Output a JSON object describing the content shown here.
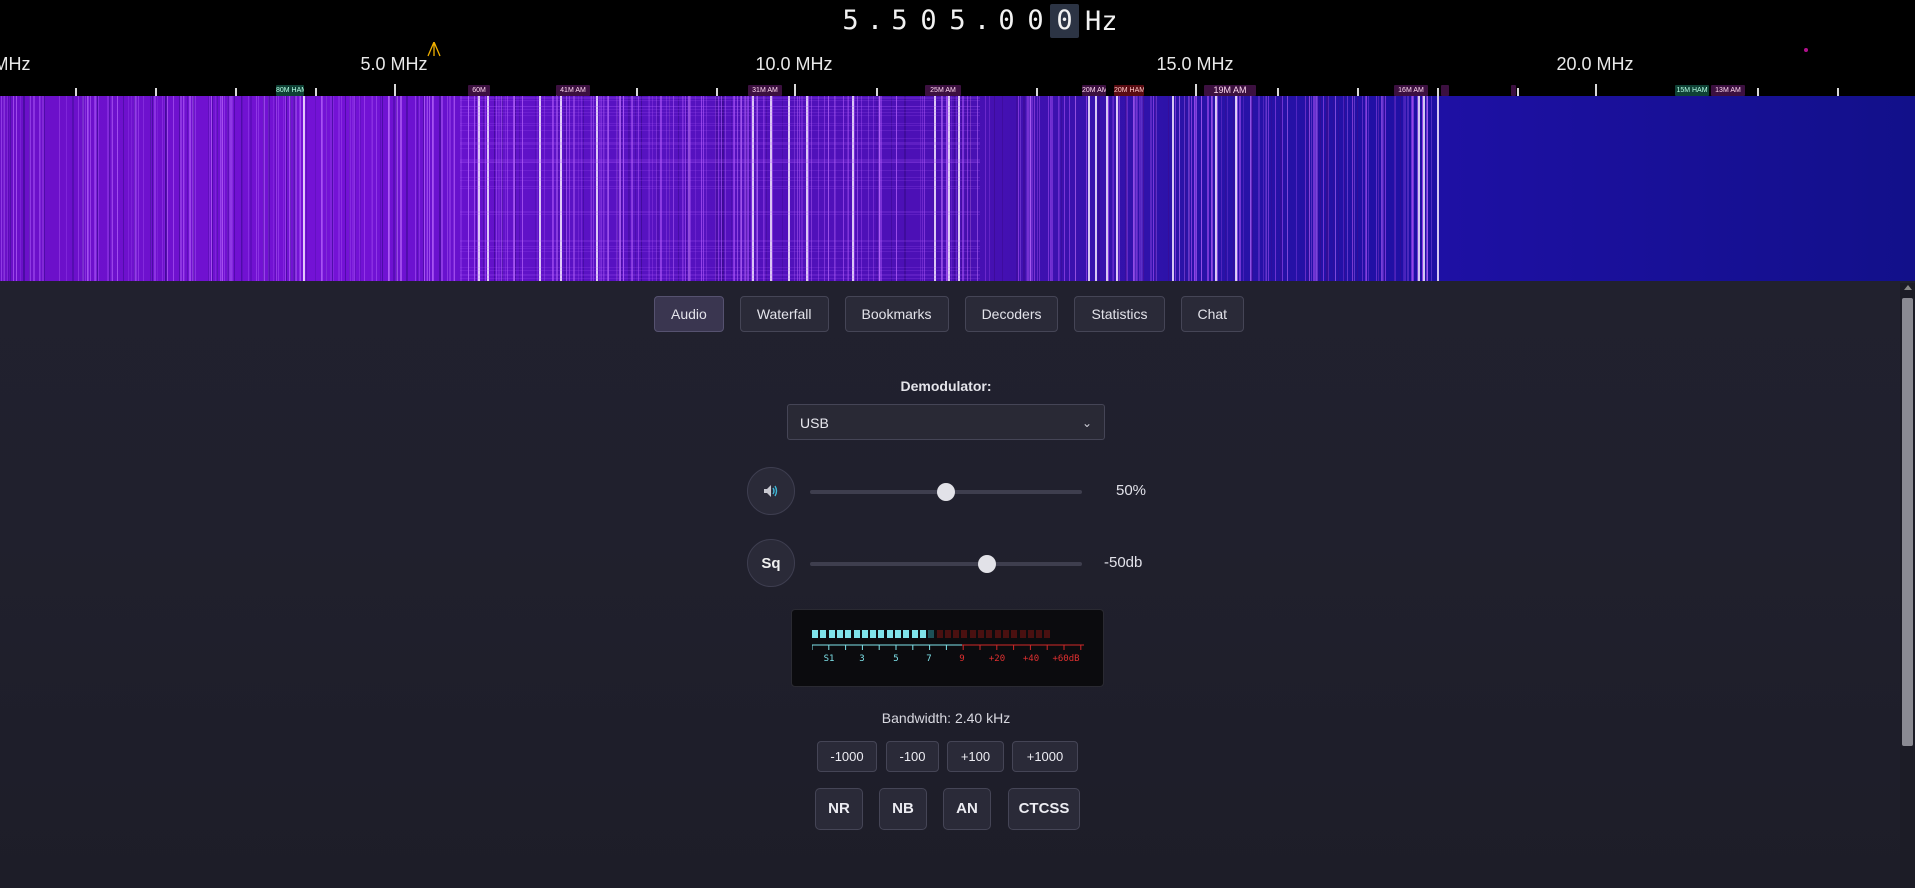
{
  "frequency": {
    "digits": [
      "5",
      ".",
      "5",
      "0",
      "5",
      ".",
      "0",
      "0",
      "0"
    ],
    "selected_digit_index": 8,
    "unit": "Hz"
  },
  "scale": {
    "labels": [
      "MHz",
      "5.0 MHz",
      "10.0 MHz",
      "15.0 MHz",
      "20.0 MHz"
    ],
    "bands": [
      "80M HAM",
      "60M",
      "41M AM",
      "31M AM",
      "25M AM",
      "20M AM",
      "20M HAM",
      "19M AM",
      "16M AM",
      "15M HAM",
      "13M AM"
    ]
  },
  "tabs": [
    {
      "label": "Audio",
      "active": true
    },
    {
      "label": "Waterfall",
      "active": false
    },
    {
      "label": "Bookmarks",
      "active": false
    },
    {
      "label": "Decoders",
      "active": false
    },
    {
      "label": "Statistics",
      "active": false
    },
    {
      "label": "Chat",
      "active": false
    }
  ],
  "demodulator": {
    "label": "Demodulator:",
    "value": "USB"
  },
  "volume": {
    "icon": "speaker-icon",
    "percent": 50,
    "value_text": "50%"
  },
  "squelch": {
    "button_label": "Sq",
    "level_fraction": 0.65,
    "value_text": "-50db"
  },
  "smeter": {
    "labels": [
      "S1",
      "3",
      "5",
      "7",
      "9",
      "+20",
      "+40",
      "+60dB"
    ],
    "active_segments": 14,
    "total_segments": 29,
    "colors": {
      "cyan": "#7fe3ea",
      "dim_cyan": "#1c5057",
      "red": "#4a1010",
      "red_text": "#e03030"
    }
  },
  "bandwidth": {
    "text": "Bandwidth: 2.40 kHz"
  },
  "step_buttons": [
    "-1000",
    "-100",
    "+100",
    "+1000"
  ],
  "option_buttons": [
    "NR",
    "NB",
    "AN",
    "CTCSS"
  ],
  "colors": {
    "waterfall_purple": "#7a10d8",
    "waterfall_blue": "#1c10a0",
    "tick_color": "#d8d8d8",
    "marker": "#f0b000"
  }
}
